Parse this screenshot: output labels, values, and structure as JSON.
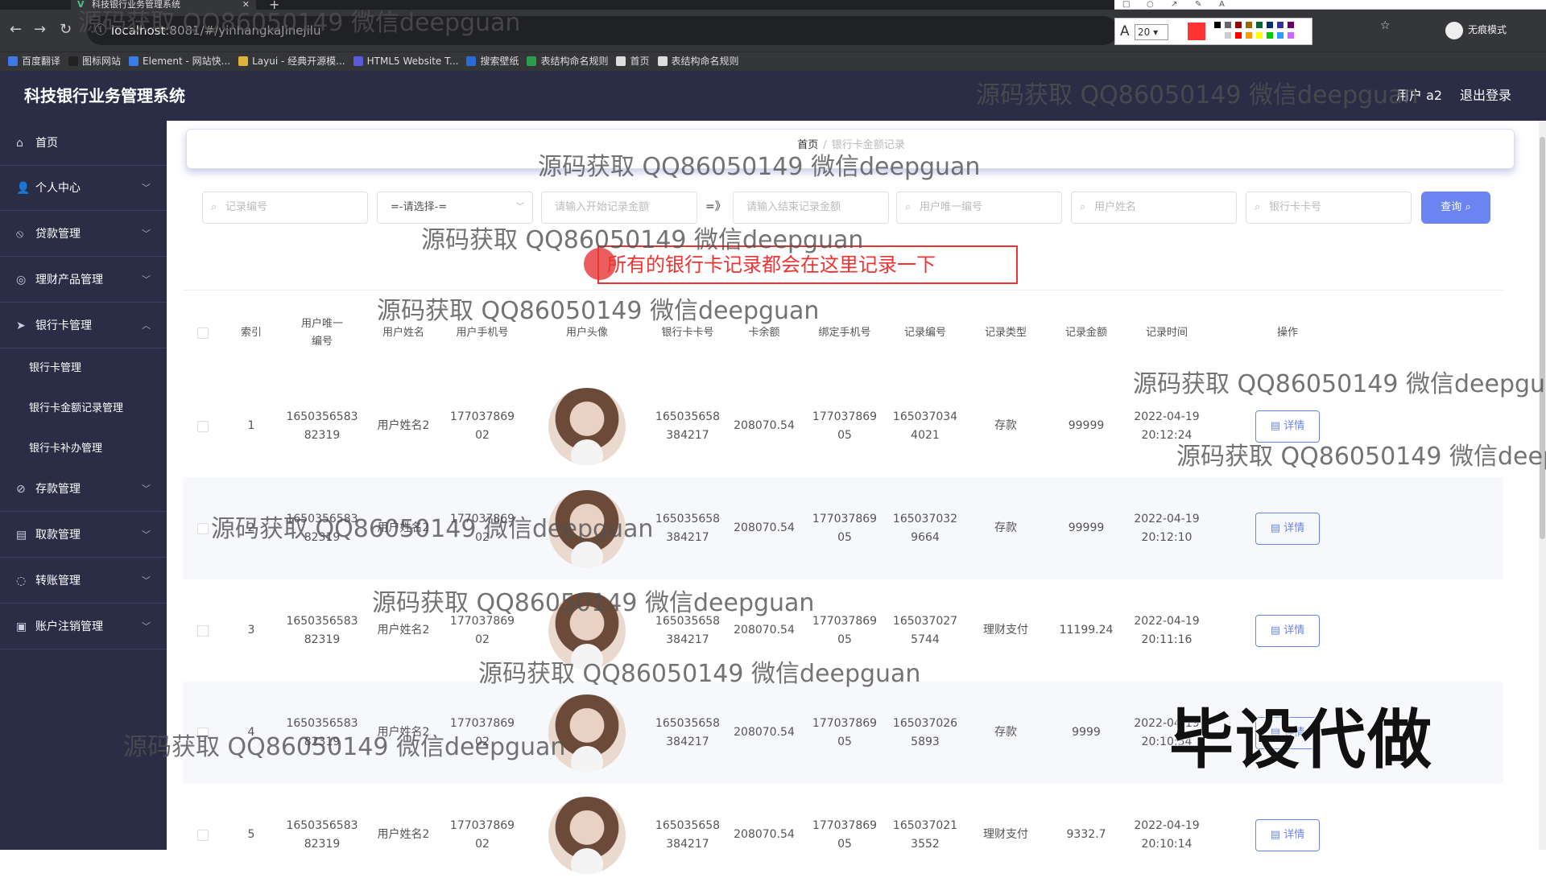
{
  "browser": {
    "tab_title": "科技银行业务管理系统",
    "url_host": "localhost",
    "url_rest": ":8081/#/yinhangkaJinejilu",
    "incognito_label": "无痕模式",
    "bookmarks": [
      "百度翻译",
      "图标网站",
      "Element - 网站快...",
      "Layui - 经典开源模...",
      "HTML5 Website T...",
      "搜索壁纸",
      "表结构命名规则",
      "首页",
      "表结构命名规则"
    ],
    "font_size": "20"
  },
  "app": {
    "title": "科技银行业务管理系统",
    "user_label": "用户 a2",
    "logout_label": "退出登录"
  },
  "sidebar": {
    "items": [
      {
        "label": "首页",
        "icon": "home-icon"
      },
      {
        "label": "个人中心",
        "icon": "user-icon"
      },
      {
        "label": "贷款管理",
        "icon": "loan-icon"
      },
      {
        "label": "理财产品管理",
        "icon": "product-icon"
      },
      {
        "label": "银行卡管理",
        "icon": "send-icon"
      },
      {
        "label": "存款管理",
        "icon": "deposit-icon"
      },
      {
        "label": "取款管理",
        "icon": "withdraw-icon"
      },
      {
        "label": "转账管理",
        "icon": "transfer-icon"
      },
      {
        "label": "账户注销管理",
        "icon": "account-icon"
      }
    ],
    "sub_items": [
      "银行卡管理",
      "银行卡金额记录管理",
      "银行卡补办管理"
    ]
  },
  "breadcrumb": {
    "home": "首页",
    "sep": "/",
    "current": "银行卡金额记录"
  },
  "search": {
    "record_no_placeholder": "记录编号",
    "select_value": "=-请选择-=",
    "start_amount_placeholder": "请输入开始记录金额",
    "arrow": "=》",
    "end_amount_placeholder": "请输入结束记录金额",
    "user_id_placeholder": "用户唯一编号",
    "user_name_placeholder": "用户姓名",
    "card_no_placeholder": "银行卡卡号",
    "button_label": "查询"
  },
  "annotation": "所有的银行卡记录都会在这里记录一下",
  "table": {
    "headers": [
      "索引",
      "用户唯一编号",
      "用户姓名",
      "用户手机号",
      "用户头像",
      "银行卡卡号",
      "卡余额",
      "绑定手机号",
      "记录编号",
      "记录类型",
      "记录金额",
      "记录时间",
      "操作"
    ],
    "detail_label": "详情",
    "rows": [
      {
        "index": "1",
        "user_id": "1650356583\n82319",
        "name": "用户姓名2",
        "phone": "177037869\n02",
        "card": "165035658\n384217",
        "balance": "208070.54",
        "bind_phone": "177037869\n05",
        "record_no": "165037034\n4021",
        "type": "存款",
        "amount": "99999",
        "time": "2022-04-19\n20:12:24"
      },
      {
        "index": "2",
        "user_id": "1650356583\n82319",
        "name": "用户姓名2",
        "phone": "177037869\n02",
        "card": "165035658\n384217",
        "balance": "208070.54",
        "bind_phone": "177037869\n05",
        "record_no": "165037032\n9664",
        "type": "存款",
        "amount": "99999",
        "time": "2022-04-19\n20:12:10"
      },
      {
        "index": "3",
        "user_id": "1650356583\n82319",
        "name": "用户姓名2",
        "phone": "177037869\n02",
        "card": "165035658\n384217",
        "balance": "208070.54",
        "bind_phone": "177037869\n05",
        "record_no": "165037027\n5744",
        "type": "理财支付",
        "amount": "11199.24",
        "time": "2022-04-19\n20:11:16"
      },
      {
        "index": "4",
        "user_id": "1650356583\n82319",
        "name": "用户姓名2",
        "phone": "177037869\n02",
        "card": "165035658\n384217",
        "balance": "208070.54",
        "bind_phone": "177037869\n05",
        "record_no": "165037026\n5893",
        "type": "存款",
        "amount": "9999",
        "time": "2022-04-19\n20:10:54"
      },
      {
        "index": "5",
        "user_id": "1650356583\n82319",
        "name": "用户姓名2",
        "phone": "177037869\n02",
        "card": "165035658\n384217",
        "balance": "208070.54",
        "bind_phone": "177037869\n05",
        "record_no": "165037021\n3552",
        "type": "理财支付",
        "amount": "9332.7",
        "time": "2022-04-19\n20:10:14"
      }
    ]
  },
  "watermark_text": "源码获取 QQ86050149 微信deepguan",
  "overlay_text": "毕设代做"
}
